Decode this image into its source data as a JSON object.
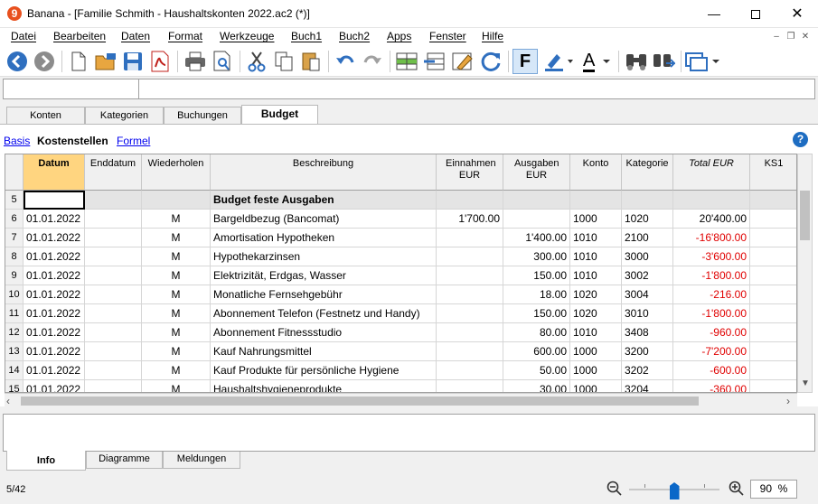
{
  "app": {
    "title": "Banana - [Familie Schmith - Haushaltskonten 2022.ac2 (*)]",
    "icon_glyph": "9",
    "window_buttons": [
      "minimize-icon",
      "maximize-icon",
      "close-icon"
    ]
  },
  "menu": [
    "Datei",
    "Bearbeiten",
    "Daten",
    "Format",
    "Werkzeuge",
    "Buch1",
    "Buch2",
    "Apps",
    "Fenster",
    "Hilfe"
  ],
  "toolbar": {
    "bold_label": "F",
    "font_color_label": "A"
  },
  "tabs": [
    "Konten",
    "Kategorien",
    "Buchungen",
    "Budget"
  ],
  "views": {
    "basis": "Basis",
    "kostenstellen": "Kostenstellen",
    "formel": "Formel"
  },
  "help_glyph": "?",
  "columns": [
    "Datum",
    "Enddatum",
    "Wiederholen",
    "Beschreibung",
    "Einnahmen EUR",
    "Ausgaben EUR",
    "Konto",
    "Kategorie",
    "Total EUR",
    "KS1"
  ],
  "rows": [
    {
      "n": "5",
      "datum": "",
      "enddatum": "",
      "wdh": "",
      "beschr": "Budget feste Ausgaben",
      "einn": "",
      "ausg": "",
      "konto": "",
      "kat": "",
      "total": "",
      "ks1": ""
    },
    {
      "n": "6",
      "datum": "01.01.2022",
      "enddatum": "",
      "wdh": "M",
      "beschr": "Bargeldbezug (Bancomat)",
      "einn": "1'700.00",
      "ausg": "",
      "konto": "1000",
      "kat": "1020",
      "total": "20'400.00",
      "ks1": ""
    },
    {
      "n": "7",
      "datum": "01.01.2022",
      "enddatum": "",
      "wdh": "M",
      "beschr": "Amortisation Hypotheken",
      "einn": "",
      "ausg": "1'400.00",
      "konto": "1010",
      "kat": "2100",
      "total": "-16'800.00",
      "ks1": ""
    },
    {
      "n": "8",
      "datum": "01.01.2022",
      "enddatum": "",
      "wdh": "M",
      "beschr": "Hypothekarzinsen",
      "einn": "",
      "ausg": "300.00",
      "konto": "1010",
      "kat": "3000",
      "total": "-3'600.00",
      "ks1": ""
    },
    {
      "n": "9",
      "datum": "01.01.2022",
      "enddatum": "",
      "wdh": "M",
      "beschr": "Elektrizität, Erdgas, Wasser",
      "einn": "",
      "ausg": "150.00",
      "konto": "1010",
      "kat": "3002",
      "total": "-1'800.00",
      "ks1": ""
    },
    {
      "n": "10",
      "datum": "01.01.2022",
      "enddatum": "",
      "wdh": "M",
      "beschr": "Monatliche Fernsehgebühr",
      "einn": "",
      "ausg": "18.00",
      "konto": "1020",
      "kat": "3004",
      "total": "-216.00",
      "ks1": ""
    },
    {
      "n": "11",
      "datum": "01.01.2022",
      "enddatum": "",
      "wdh": "M",
      "beschr": "Abonnement Telefon (Festnetz und Handy)",
      "einn": "",
      "ausg": "150.00",
      "konto": "1020",
      "kat": "3010",
      "total": "-1'800.00",
      "ks1": ""
    },
    {
      "n": "12",
      "datum": "01.01.2022",
      "enddatum": "",
      "wdh": "M",
      "beschr": "Abonnement Fitnessstudio",
      "einn": "",
      "ausg": "80.00",
      "konto": "1010",
      "kat": "3408",
      "total": "-960.00",
      "ks1": ""
    },
    {
      "n": "13",
      "datum": "01.01.2022",
      "enddatum": "",
      "wdh": "M",
      "beschr": "Kauf Nahrungsmittel",
      "einn": "",
      "ausg": "600.00",
      "konto": "1000",
      "kat": "3200",
      "total": "-7'200.00",
      "ks1": ""
    },
    {
      "n": "14",
      "datum": "01.01.2022",
      "enddatum": "",
      "wdh": "M",
      "beschr": "Kauf Produkte für persönliche Hygiene",
      "einn": "",
      "ausg": "50.00",
      "konto": "1000",
      "kat": "3202",
      "total": "-600.00",
      "ks1": ""
    },
    {
      "n": "15",
      "datum": "01.01.2022",
      "enddatum": "",
      "wdh": "M",
      "beschr": "Haushaltshygieneprodukte",
      "einn": "",
      "ausg": "30.00",
      "konto": "1000",
      "kat": "3204",
      "total": "-360.00",
      "ks1": ""
    }
  ],
  "bottom_tabs": [
    "Info",
    "Diagramme",
    "Meldungen"
  ],
  "status": {
    "position": "5/42",
    "zoom_value": "90",
    "zoom_unit": "%",
    "zoom_level": 0.5
  },
  "colors": {
    "accent": "#1e6dc2",
    "negative": "#e00000",
    "header_bg": "#f0f0f0",
    "active_column_header": "#ffd580"
  }
}
